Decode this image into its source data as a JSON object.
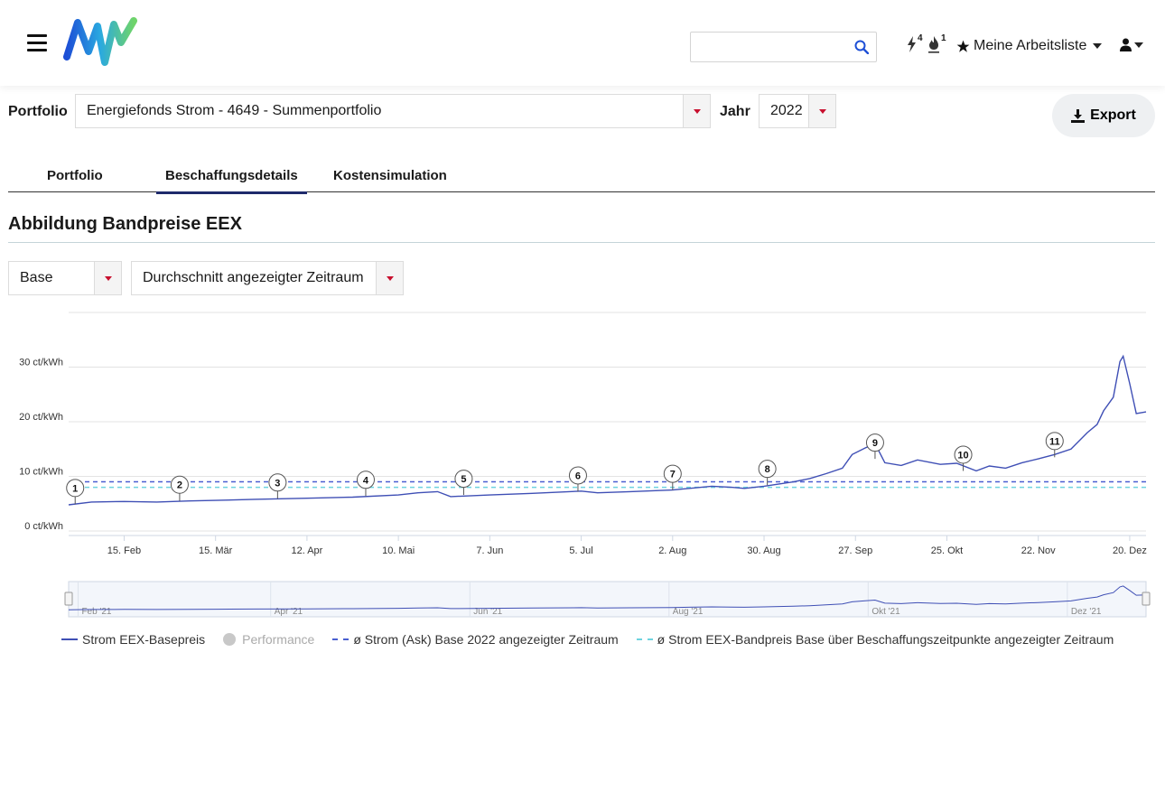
{
  "header": {
    "search_placeholder": "",
    "notif_power_count": "4",
    "notif_gas_count": "1",
    "worklist_label": "Meine Arbeitsliste"
  },
  "filters": {
    "portfolio_label": "Portfolio",
    "portfolio_value": "Energiefonds Strom - 4649 - Summenportfolio",
    "year_label": "Jahr",
    "year_value": "2022",
    "export_label": "Export"
  },
  "tabs": [
    {
      "label": "Portfolio",
      "active": false
    },
    {
      "label": "Beschaffungsdetails",
      "active": true
    },
    {
      "label": "Kostensimulation",
      "active": false
    }
  ],
  "section": {
    "title": "Abbildung Bandpreise EEX",
    "product_value": "Base",
    "mode_value": "Durchschnitt angezeigter Zeitraum"
  },
  "colors": {
    "series_main": "#3f4fb5",
    "series_avg_ask": "#4a5fd1",
    "series_avg_band": "#6ed3df",
    "marker_stroke": "#555555"
  },
  "chart_data": {
    "type": "line",
    "ylabel": "",
    "xlabel": "",
    "y_ticks": [
      "0 ct/kWh",
      "10 ct/kWh",
      "20 ct/kWh",
      "30 ct/kWh"
    ],
    "y_tick_values": [
      0,
      10,
      20,
      30
    ],
    "ylim": [
      0,
      40
    ],
    "x_ticks": [
      "15. Feb",
      "15. Mär",
      "12. Apr",
      "10. Mai",
      "7. Jun",
      "5. Jul",
      "2. Aug",
      "30. Aug",
      "27. Sep",
      "25. Okt",
      "22. Nov",
      "20. Dez"
    ],
    "x_tick_days": [
      45,
      73,
      101,
      129,
      157,
      185,
      213,
      241,
      269,
      297,
      325,
      353
    ],
    "x_range_days": [
      28,
      358
    ],
    "grid": true,
    "series": [
      {
        "name": "Strom EEX-Basepreis",
        "style": "solid",
        "x": [
          28,
          35,
          45,
          55,
          65,
          73,
          85,
          101,
          115,
          129,
          135,
          141,
          145,
          157,
          170,
          185,
          190,
          200,
          213,
          225,
          231,
          235,
          241,
          250,
          255,
          260,
          265,
          268,
          272,
          275,
          278,
          283,
          288,
          295,
          300,
          306,
          310,
          315,
          320,
          325,
          330,
          335,
          340,
          343,
          345,
          348,
          350,
          351,
          353,
          355,
          358
        ],
        "y": [
          4.8,
          5.3,
          5.4,
          5.3,
          5.5,
          5.6,
          5.8,
          6.0,
          6.2,
          6.6,
          7.0,
          7.2,
          6.3,
          6.6,
          6.9,
          7.3,
          7.0,
          7.2,
          7.5,
          8.2,
          8.0,
          7.8,
          8.2,
          9.0,
          9.6,
          10.5,
          11.5,
          14.0,
          15.2,
          16.0,
          12.5,
          12.0,
          13.0,
          12.2,
          12.4,
          11.0,
          11.9,
          11.5,
          12.5,
          13.2,
          14.0,
          15.0,
          18.0,
          19.5,
          22.0,
          24.5,
          31.0,
          32.0,
          27.0,
          21.5,
          21.8
        ]
      },
      {
        "name": "Performance",
        "style": "marker",
        "x": [],
        "y": []
      },
      {
        "name": "ø Strom (Ask) Base 2022 angezeigter Zeitraum",
        "style": "dashed",
        "x": [
          28,
          358
        ],
        "y": [
          9.0,
          9.0
        ]
      },
      {
        "name": "ø Strom EEX-Bandpreis Base über Beschaffungszeitpunkte angezeigter Zeitraum",
        "style": "dashed",
        "x": [
          28,
          358
        ],
        "y": [
          8.0,
          8.0
        ]
      }
    ],
    "flags": [
      {
        "label": "1",
        "x": 30,
        "y": 4.9
      },
      {
        "label": "2",
        "x": 62,
        "y": 5.5
      },
      {
        "label": "3",
        "x": 92,
        "y": 5.9
      },
      {
        "label": "4",
        "x": 119,
        "y": 6.4
      },
      {
        "label": "5",
        "x": 149,
        "y": 6.6
      },
      {
        "label": "6",
        "x": 184,
        "y": 7.2
      },
      {
        "label": "7",
        "x": 213,
        "y": 7.5
      },
      {
        "label": "8",
        "x": 242,
        "y": 8.4
      },
      {
        "label": "9",
        "x": 275,
        "y": 13.2
      },
      {
        "label": "10",
        "x": 302,
        "y": 11.0
      },
      {
        "label": "11",
        "x": 330,
        "y": 13.5
      }
    ],
    "navigator": {
      "labels": [
        "Feb '21",
        "Apr '21",
        "Jun '21",
        "Aug '21",
        "Okt '21",
        "Dez '21"
      ],
      "label_days": [
        32,
        91,
        152,
        213,
        274,
        335
      ],
      "range_days": [
        28,
        358
      ]
    }
  }
}
